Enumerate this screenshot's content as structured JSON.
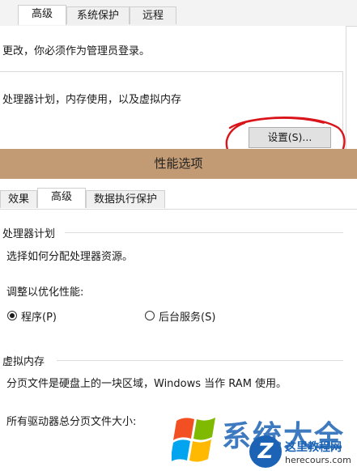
{
  "system_properties": {
    "tabs": [
      {
        "label": "高级",
        "active": true
      },
      {
        "label": "系统保护",
        "active": false
      },
      {
        "label": "远程",
        "active": false
      }
    ],
    "admin_notice": "更改，你必须作为管理员登录。",
    "performance_desc": "处理器计划，内存使用，以及虚拟内存",
    "settings_button": "设置(S)..."
  },
  "performance_options": {
    "title": "性能选项",
    "tabs": [
      {
        "label": "效果",
        "active": false
      },
      {
        "label": "高级",
        "active": true
      },
      {
        "label": "数据执行保护",
        "active": false
      }
    ],
    "processor_section": {
      "title": "处理器计划",
      "description": "选择如何分配处理器资源。",
      "adjust_label": "调整以优化性能:",
      "options": [
        {
          "label": "程序(P)",
          "selected": true
        },
        {
          "label": "后台服务(S)",
          "selected": false
        }
      ]
    },
    "virtual_memory_section": {
      "title": "虚拟内存",
      "description": "分页文件是硬盘上的一块区域，Windows 当作 RAM 使用。",
      "total_size_label": "所有驱动器总分页文件大小:"
    }
  },
  "annotation": {
    "color": "#d9151b"
  },
  "watermark": {
    "text": "系统大全",
    "site_title": "这里教程网",
    "site_url": "herecours.com",
    "badge_letter": "Z"
  },
  "colors": {
    "titlebar": "#c29a73",
    "watermark_blue": "#1c63b5"
  }
}
